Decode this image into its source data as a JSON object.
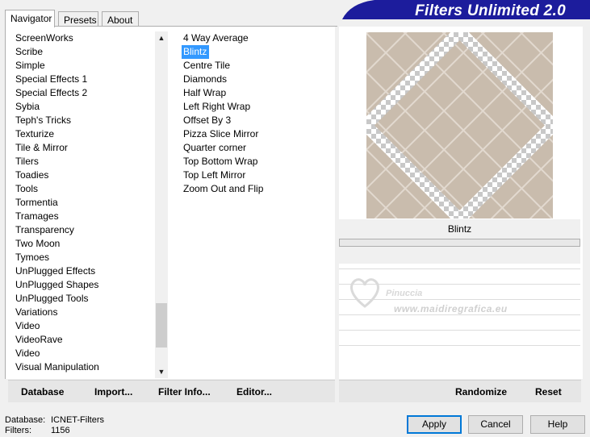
{
  "tabs": [
    {
      "label": "Navigator",
      "active": true
    },
    {
      "label": "Presets",
      "active": false
    },
    {
      "label": "About",
      "active": false
    }
  ],
  "banner": {
    "title": "Filters Unlimited 2.0",
    "color": "#1c1c9c"
  },
  "categories": [
    "ScreenWorks",
    "Scribe",
    "Simple",
    "Special Effects 1",
    "Special Effects 2",
    "Sybia",
    "Teph's Tricks",
    "Texturize",
    "Tile & Mirror",
    "Tilers",
    "Toadies",
    "Tools",
    "Tormentia",
    "Tramages",
    "Transparency",
    "Two Moon",
    "Tymoes",
    "UnPlugged Effects",
    "UnPlugged Shapes",
    "UnPlugged Tools",
    "Variations",
    "Video",
    "VideoRave",
    "Video",
    "Visual Manipulation"
  ],
  "filters": [
    {
      "label": "4 Way Average",
      "selected": false
    },
    {
      "label": "Blintz",
      "selected": true
    },
    {
      "label": "Centre Tile",
      "selected": false
    },
    {
      "label": "Diamonds",
      "selected": false
    },
    {
      "label": "Half Wrap",
      "selected": false
    },
    {
      "label": "Left Right Wrap",
      "selected": false
    },
    {
      "label": "Offset By 3",
      "selected": false
    },
    {
      "label": "Pizza Slice Mirror",
      "selected": false
    },
    {
      "label": "Quarter corner",
      "selected": false
    },
    {
      "label": "Top Bottom Wrap",
      "selected": false
    },
    {
      "label": "Top Left Mirror",
      "selected": false
    },
    {
      "label": "Zoom Out and Flip",
      "selected": false
    }
  ],
  "preview": {
    "label": "Blintz",
    "tile_color": "#c9bcad",
    "line_color": "#e2d9cf"
  },
  "watermark": {
    "line1": "Pinuccia",
    "line2": "www.maidiregrafica.eu"
  },
  "left_toolbar": {
    "database": "Database",
    "import": "Import...",
    "filter_info": "Filter Info...",
    "editor": "Editor..."
  },
  "right_toolbar": {
    "randomize": "Randomize",
    "reset": "Reset"
  },
  "status": {
    "database_label": "Database:",
    "database_value": "ICNET-Filters",
    "filters_label": "Filters:",
    "filters_value": "1156"
  },
  "buttons": {
    "apply": "Apply",
    "cancel": "Cancel",
    "help": "Help"
  }
}
